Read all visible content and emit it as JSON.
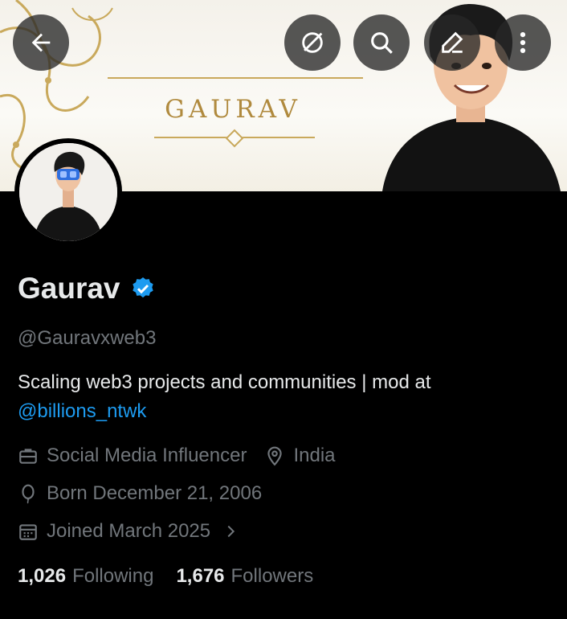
{
  "banner": {
    "title": "GAURAV"
  },
  "top_actions": {
    "back_icon": "arrow-left-icon",
    "grok_icon": "grok-icon",
    "search_icon": "search-icon",
    "edit_icon": "edit-pencil-icon",
    "more_icon": "more-vertical-icon"
  },
  "profile": {
    "name": "Gaurav",
    "verified_badge_color": "#1d9bf0",
    "handle": "@Gauravxweb3",
    "bio_text": "Scaling web3 projects and communities | mod at",
    "bio_link": "@billions_ntwk",
    "category": "Social Media Influencer",
    "location": "India",
    "birthday": "Born December 21, 2006",
    "joined": "Joined March 2025"
  },
  "stats": {
    "following_count": "1,026",
    "following_label": "Following",
    "followers_count": "1,676",
    "followers_label": "Followers"
  },
  "colors": {
    "background": "#000000",
    "text_primary": "#e7e9ea",
    "text_secondary": "#71767b",
    "link": "#1d9bf0",
    "banner_gold": "#b08a3e"
  }
}
